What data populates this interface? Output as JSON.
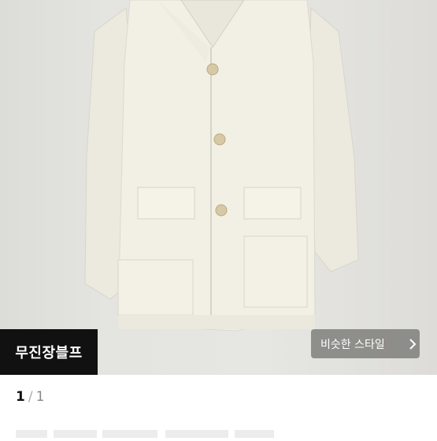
{
  "product_image": {
    "alt": "ivory coat photo",
    "badge_label": "무진장블프"
  },
  "similar_style": {
    "label": "비슷한 스타일",
    "icon": "chevron-right-icon"
  },
  "pagination": {
    "current": "1",
    "separator": "/",
    "total": "1"
  },
  "colors": {
    "badge_bg": "#111111",
    "coat": "#f2efe5",
    "wall": "#e4e4e0"
  }
}
